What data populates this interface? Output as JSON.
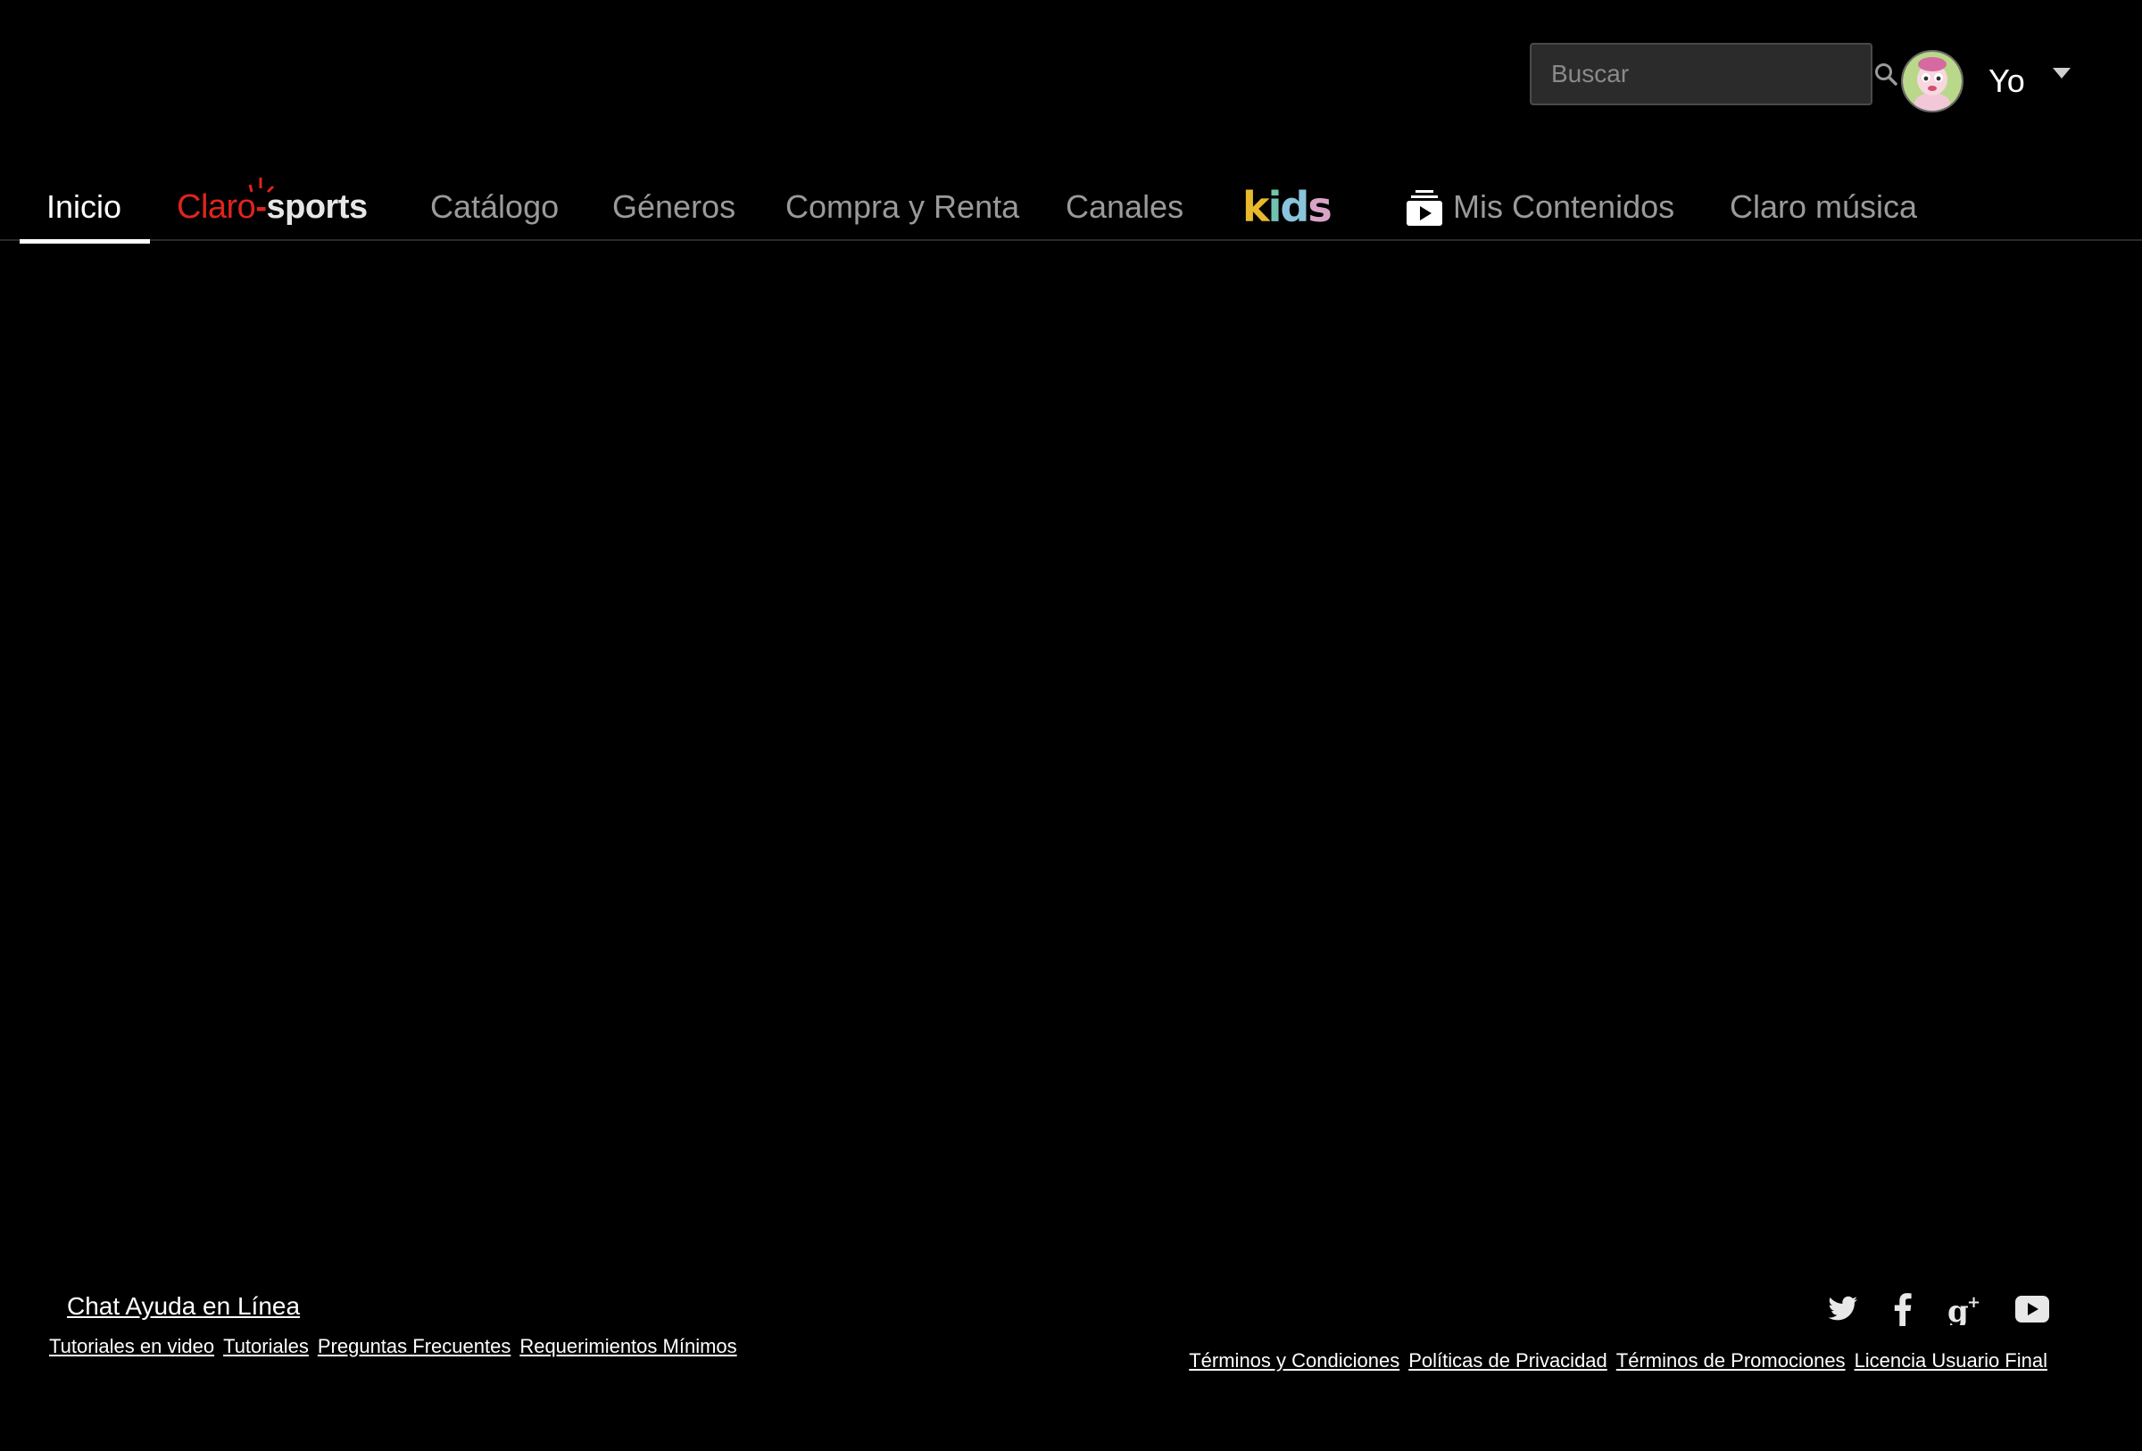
{
  "header": {
    "search": {
      "placeholder": "Buscar",
      "value": ""
    },
    "profile": {
      "name": "Yo",
      "avatar_icon": "cartoon-character-avatar"
    }
  },
  "nav": {
    "items": [
      {
        "label": "Inicio",
        "active": true
      },
      {
        "label": "Claro sports",
        "logo": "claro-sports-logo",
        "claro": "Claro",
        "sports": "sports"
      },
      {
        "label": "Catálogo"
      },
      {
        "label": "Géneros"
      },
      {
        "label": "Compra y Renta"
      },
      {
        "label": "Canales"
      },
      {
        "label": "kids",
        "logo": "kids-logo"
      },
      {
        "label": "Mis Contenidos",
        "icon": "my-content-icon"
      },
      {
        "label": "Claro música"
      }
    ]
  },
  "footer": {
    "help_chat": "Chat Ayuda en Línea",
    "left_links": [
      "Tutoriales en video",
      "Tutoriales",
      "Preguntas Frecuentes",
      "Requerimientos Mínimos"
    ],
    "right_links": [
      "Términos y Condiciones",
      "Políticas de Privacidad",
      "Términos de Promociones",
      "Licencia Usuario Final"
    ],
    "social_icons": [
      "twitter-icon",
      "facebook-icon",
      "google-plus-icon",
      "youtube-icon"
    ]
  },
  "colors": {
    "background": "#000000",
    "nav_active": "#ffffff",
    "nav_inactive": "#9a9a9a",
    "claro_red": "#e0241b"
  }
}
